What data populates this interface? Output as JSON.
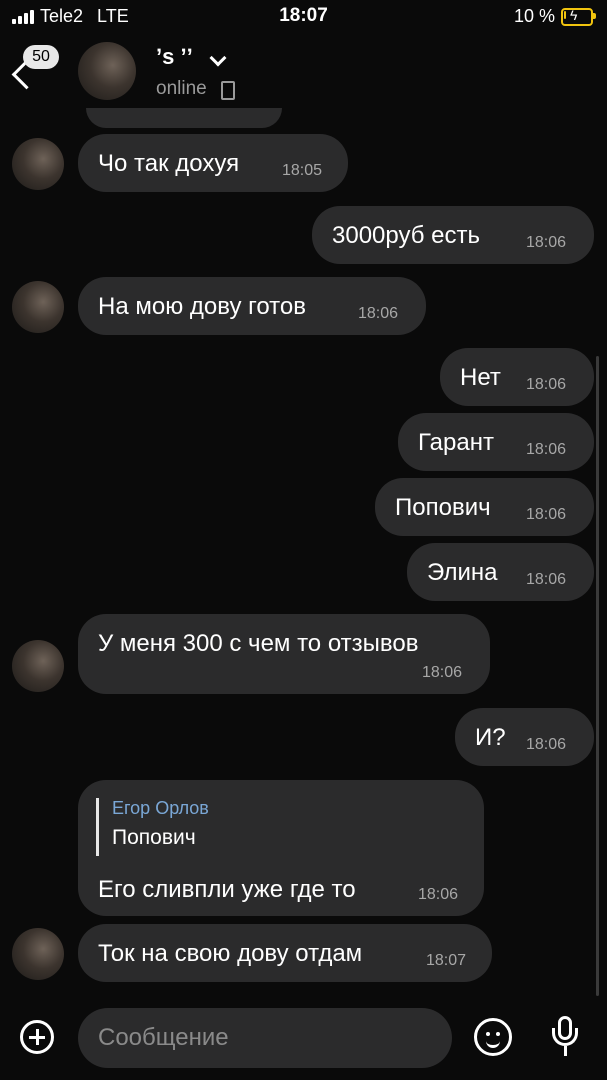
{
  "status_bar": {
    "carrier": "Tele2",
    "network": "LTE",
    "time": "18:07",
    "battery_percent": "10 %",
    "battery_level": 0.1,
    "charging": true
  },
  "header": {
    "unread_count": "50",
    "contact_name": "ʼs ʼʼ",
    "status": "online"
  },
  "messages": [
    {
      "side": "in",
      "text": "Чо так дохуя",
      "time": "18:05"
    },
    {
      "side": "out",
      "text": "3000руб есть",
      "time": "18:06"
    },
    {
      "side": "in",
      "text": "На мою дову готов",
      "time": "18:06"
    },
    {
      "side": "out",
      "text": "Нет",
      "time": "18:06"
    },
    {
      "side": "out",
      "text": "Гарант",
      "time": "18:06"
    },
    {
      "side": "out",
      "text": "Попович",
      "time": "18:06"
    },
    {
      "side": "out",
      "text": "Элина",
      "time": "18:06"
    },
    {
      "side": "in",
      "text": "У меня 300 с чем то отзывов",
      "time": "18:06"
    },
    {
      "side": "out",
      "text": "И?",
      "time": "18:06"
    },
    {
      "side": "in",
      "text": "Его сливпли уже где то",
      "time": "18:06",
      "reply_author": "Егор Орлов",
      "reply_text": "Попович"
    },
    {
      "side": "in",
      "text": "Ток на свою дову отдам",
      "time": "18:07"
    }
  ],
  "input": {
    "placeholder": "Сообщение"
  },
  "colors": {
    "background": "#0a0a0a",
    "bubble": "#2b2b2c",
    "reply_author": "#7aa7d6",
    "battery": "#f1c40f"
  },
  "icons": [
    "back-arrow-icon",
    "chevron-down-icon",
    "phone-icon",
    "plus-icon",
    "emoji-icon",
    "microphone-icon"
  ]
}
